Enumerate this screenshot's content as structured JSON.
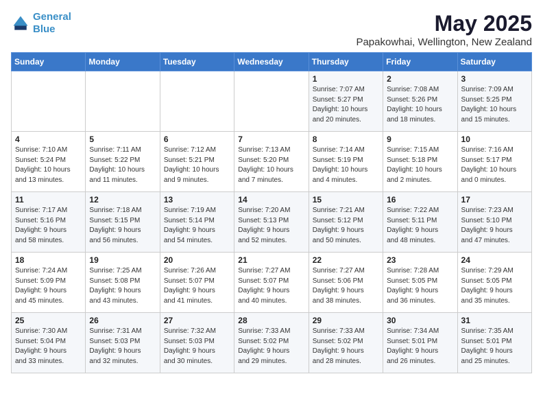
{
  "header": {
    "logo_line1": "General",
    "logo_line2": "Blue",
    "month": "May 2025",
    "location": "Papakowhai, Wellington, New Zealand"
  },
  "weekdays": [
    "Sunday",
    "Monday",
    "Tuesday",
    "Wednesday",
    "Thursday",
    "Friday",
    "Saturday"
  ],
  "weeks": [
    [
      {
        "day": "",
        "info": ""
      },
      {
        "day": "",
        "info": ""
      },
      {
        "day": "",
        "info": ""
      },
      {
        "day": "",
        "info": ""
      },
      {
        "day": "1",
        "info": "Sunrise: 7:07 AM\nSunset: 5:27 PM\nDaylight: 10 hours\nand 20 minutes."
      },
      {
        "day": "2",
        "info": "Sunrise: 7:08 AM\nSunset: 5:26 PM\nDaylight: 10 hours\nand 18 minutes."
      },
      {
        "day": "3",
        "info": "Sunrise: 7:09 AM\nSunset: 5:25 PM\nDaylight: 10 hours\nand 15 minutes."
      }
    ],
    [
      {
        "day": "4",
        "info": "Sunrise: 7:10 AM\nSunset: 5:24 PM\nDaylight: 10 hours\nand 13 minutes."
      },
      {
        "day": "5",
        "info": "Sunrise: 7:11 AM\nSunset: 5:22 PM\nDaylight: 10 hours\nand 11 minutes."
      },
      {
        "day": "6",
        "info": "Sunrise: 7:12 AM\nSunset: 5:21 PM\nDaylight: 10 hours\nand 9 minutes."
      },
      {
        "day": "7",
        "info": "Sunrise: 7:13 AM\nSunset: 5:20 PM\nDaylight: 10 hours\nand 7 minutes."
      },
      {
        "day": "8",
        "info": "Sunrise: 7:14 AM\nSunset: 5:19 PM\nDaylight: 10 hours\nand 4 minutes."
      },
      {
        "day": "9",
        "info": "Sunrise: 7:15 AM\nSunset: 5:18 PM\nDaylight: 10 hours\nand 2 minutes."
      },
      {
        "day": "10",
        "info": "Sunrise: 7:16 AM\nSunset: 5:17 PM\nDaylight: 10 hours\nand 0 minutes."
      }
    ],
    [
      {
        "day": "11",
        "info": "Sunrise: 7:17 AM\nSunset: 5:16 PM\nDaylight: 9 hours\nand 58 minutes."
      },
      {
        "day": "12",
        "info": "Sunrise: 7:18 AM\nSunset: 5:15 PM\nDaylight: 9 hours\nand 56 minutes."
      },
      {
        "day": "13",
        "info": "Sunrise: 7:19 AM\nSunset: 5:14 PM\nDaylight: 9 hours\nand 54 minutes."
      },
      {
        "day": "14",
        "info": "Sunrise: 7:20 AM\nSunset: 5:13 PM\nDaylight: 9 hours\nand 52 minutes."
      },
      {
        "day": "15",
        "info": "Sunrise: 7:21 AM\nSunset: 5:12 PM\nDaylight: 9 hours\nand 50 minutes."
      },
      {
        "day": "16",
        "info": "Sunrise: 7:22 AM\nSunset: 5:11 PM\nDaylight: 9 hours\nand 48 minutes."
      },
      {
        "day": "17",
        "info": "Sunrise: 7:23 AM\nSunset: 5:10 PM\nDaylight: 9 hours\nand 47 minutes."
      }
    ],
    [
      {
        "day": "18",
        "info": "Sunrise: 7:24 AM\nSunset: 5:09 PM\nDaylight: 9 hours\nand 45 minutes."
      },
      {
        "day": "19",
        "info": "Sunrise: 7:25 AM\nSunset: 5:08 PM\nDaylight: 9 hours\nand 43 minutes."
      },
      {
        "day": "20",
        "info": "Sunrise: 7:26 AM\nSunset: 5:07 PM\nDaylight: 9 hours\nand 41 minutes."
      },
      {
        "day": "21",
        "info": "Sunrise: 7:27 AM\nSunset: 5:07 PM\nDaylight: 9 hours\nand 40 minutes."
      },
      {
        "day": "22",
        "info": "Sunrise: 7:27 AM\nSunset: 5:06 PM\nDaylight: 9 hours\nand 38 minutes."
      },
      {
        "day": "23",
        "info": "Sunrise: 7:28 AM\nSunset: 5:05 PM\nDaylight: 9 hours\nand 36 minutes."
      },
      {
        "day": "24",
        "info": "Sunrise: 7:29 AM\nSunset: 5:05 PM\nDaylight: 9 hours\nand 35 minutes."
      }
    ],
    [
      {
        "day": "25",
        "info": "Sunrise: 7:30 AM\nSunset: 5:04 PM\nDaylight: 9 hours\nand 33 minutes."
      },
      {
        "day": "26",
        "info": "Sunrise: 7:31 AM\nSunset: 5:03 PM\nDaylight: 9 hours\nand 32 minutes."
      },
      {
        "day": "27",
        "info": "Sunrise: 7:32 AM\nSunset: 5:03 PM\nDaylight: 9 hours\nand 30 minutes."
      },
      {
        "day": "28",
        "info": "Sunrise: 7:33 AM\nSunset: 5:02 PM\nDaylight: 9 hours\nand 29 minutes."
      },
      {
        "day": "29",
        "info": "Sunrise: 7:33 AM\nSunset: 5:02 PM\nDaylight: 9 hours\nand 28 minutes."
      },
      {
        "day": "30",
        "info": "Sunrise: 7:34 AM\nSunset: 5:01 PM\nDaylight: 9 hours\nand 26 minutes."
      },
      {
        "day": "31",
        "info": "Sunrise: 7:35 AM\nSunset: 5:01 PM\nDaylight: 9 hours\nand 25 minutes."
      }
    ]
  ]
}
